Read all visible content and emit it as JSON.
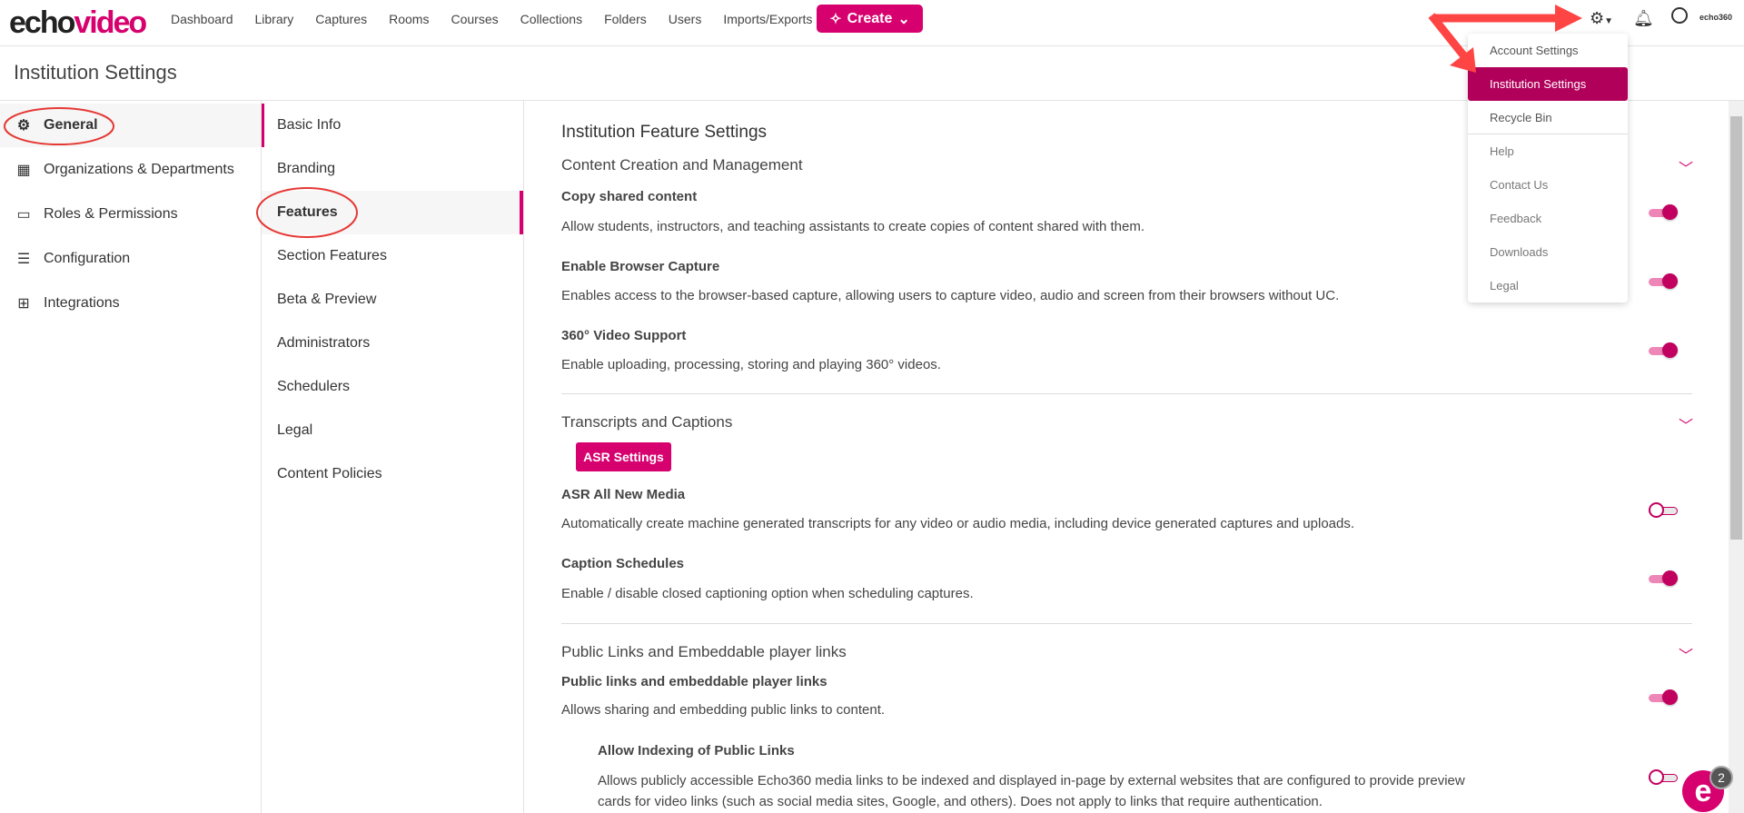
{
  "brand": {
    "logo_a": "echo",
    "logo_b": "video",
    "corner_logo": "echo360",
    "accent": "#d6006e"
  },
  "nav": {
    "items": [
      "Dashboard",
      "Library",
      "Captures",
      "Rooms",
      "Courses",
      "Collections",
      "Folders",
      "Users",
      "Imports/Exports"
    ],
    "create_label": "Create"
  },
  "header_icons": [
    "gear-icon",
    "bell-icon",
    "user-circle-icon"
  ],
  "page_title": "Institution Settings",
  "sidebar": {
    "items": [
      {
        "label": "General",
        "icon": "gear-icon",
        "active": true
      },
      {
        "label": "Organizations & Departments",
        "icon": "building-icon"
      },
      {
        "label": "Roles & Permissions",
        "icon": "id-card-icon"
      },
      {
        "label": "Configuration",
        "icon": "sliders-icon"
      },
      {
        "label": "Integrations",
        "icon": "network-icon"
      }
    ]
  },
  "subnav": {
    "items": [
      {
        "label": "Basic Info"
      },
      {
        "label": "Branding"
      },
      {
        "label": "Features",
        "active": true
      },
      {
        "label": "Section Features"
      },
      {
        "label": "Beta & Preview"
      },
      {
        "label": "Administrators"
      },
      {
        "label": "Schedulers"
      },
      {
        "label": "Legal"
      },
      {
        "label": "Content Policies"
      }
    ]
  },
  "main": {
    "title": "Institution Feature Settings",
    "sections": [
      {
        "title": "Content Creation and Management",
        "settings": [
          {
            "label": "Copy shared content",
            "desc": "Allow students, instructors, and teaching assistants to create copies of content shared with them.",
            "on": true
          },
          {
            "label": "Enable Browser Capture",
            "desc": "Enables access to the browser-based capture, allowing users to capture video, audio and screen from their browsers without UC.",
            "on": true
          },
          {
            "label": "360° Video Support",
            "desc": "Enable uploading, processing, storing and playing 360° videos.",
            "on": true
          }
        ]
      },
      {
        "title": "Transcripts and Captions",
        "button": "ASR Settings",
        "settings": [
          {
            "label": "ASR All New Media",
            "desc": "Automatically create machine generated transcripts for any video or audio media, including device generated captures and uploads.",
            "on": false
          },
          {
            "label": "Caption Schedules",
            "desc": "Enable / disable closed captioning option when scheduling captures.",
            "on": true
          }
        ]
      },
      {
        "title": "Public Links and Embeddable player links",
        "settings": [
          {
            "label": "Public links and embeddable player links",
            "desc": "Allows sharing and embedding public links to content.",
            "on": true
          },
          {
            "label": "Allow Indexing of Public Links",
            "desc": "Allows publicly accessible Echo360 media links to be indexed and displayed in-page by external websites that are configured to provide preview",
            "desc2": "cards for video links (such as social media sites, Google, and others). Does not apply to links that require authentication.",
            "on": false
          }
        ]
      }
    ]
  },
  "menu": {
    "items": [
      "Account Settings",
      "Institution Settings",
      "Recycle Bin",
      "Help",
      "Contact Us",
      "Feedback",
      "Downloads",
      "Legal"
    ],
    "active": "Institution Settings"
  },
  "chat": {
    "letter": "e",
    "badge": "2"
  }
}
